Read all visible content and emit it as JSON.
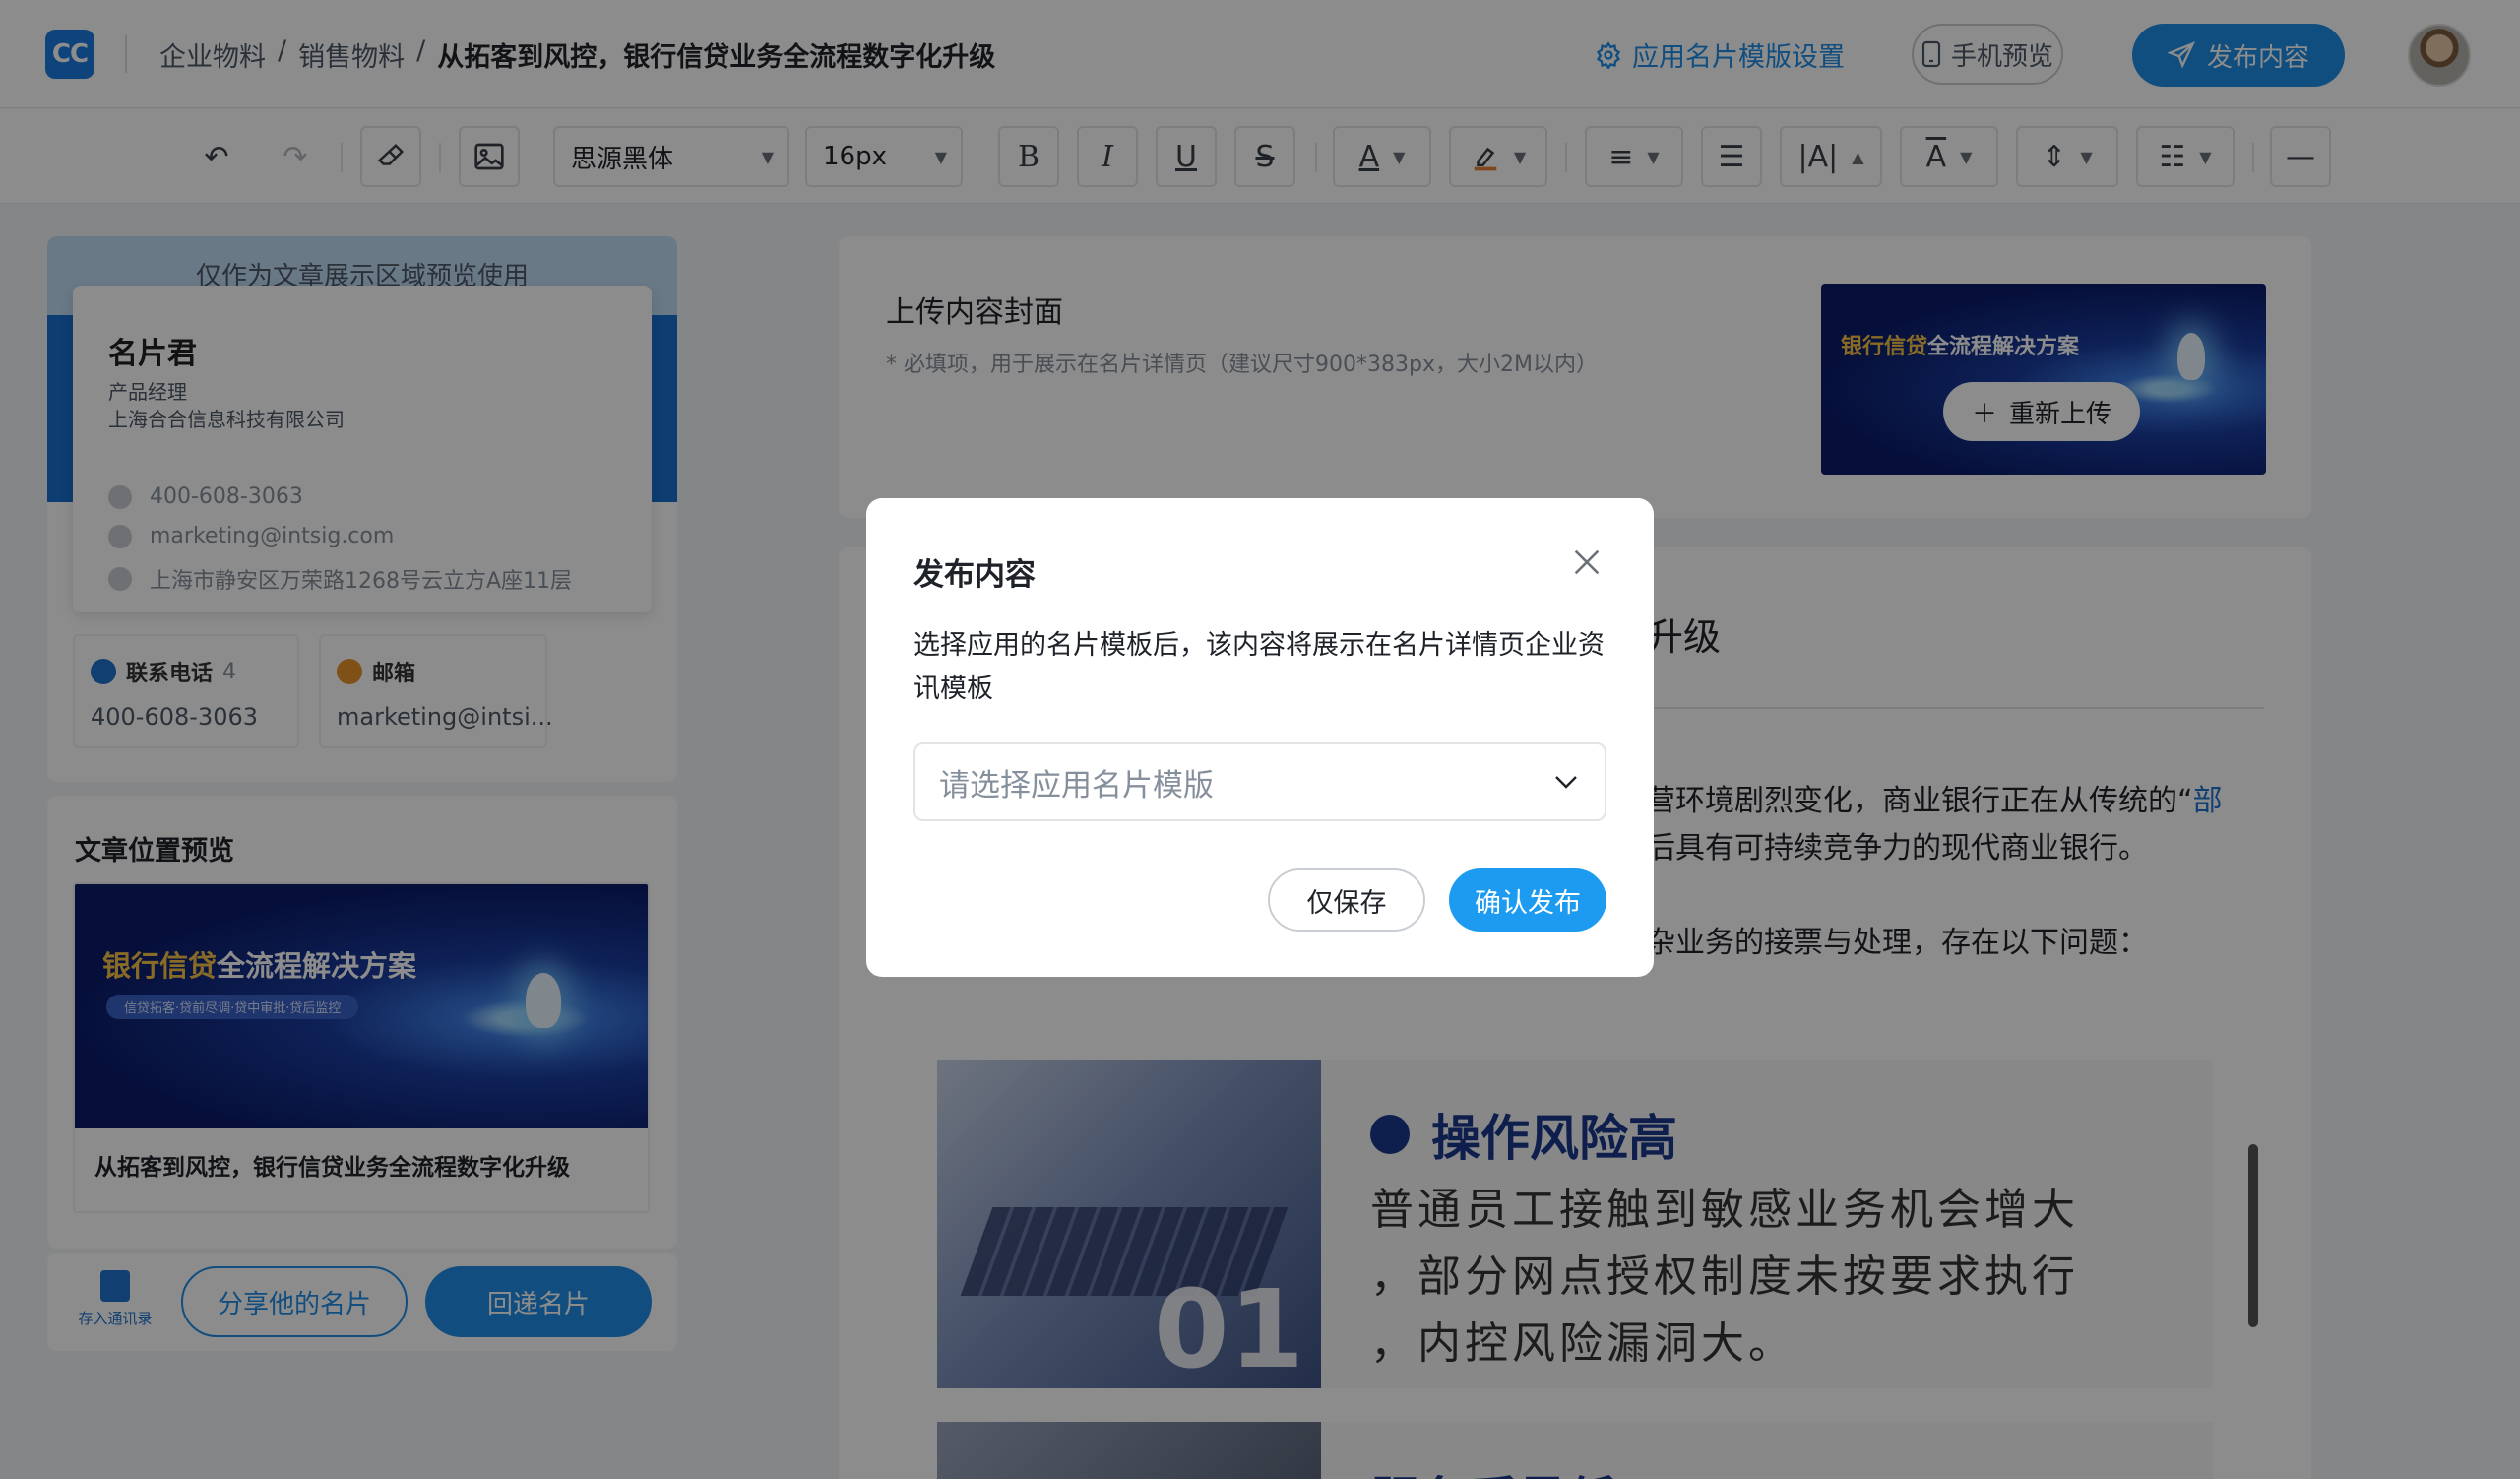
{
  "header": {
    "logo_text": "CC",
    "breadcrumb": [
      "企业物料",
      "销售物料",
      "从拓客到风控，银行信贷业务全流程数字化升级"
    ],
    "breadcrumb_sep": "/",
    "template_settings_label": "应用名片模版设置",
    "mobile_preview_label": "手机预览",
    "publish_label": "发布内容"
  },
  "toolbar": {
    "font_family": "思源黑体",
    "font_size": "16px"
  },
  "card_preview": {
    "note": "仅作为文章展示区域预览使用",
    "name": "名片君",
    "title": "产品经理",
    "company": "上海合合信息科技有限公司",
    "phone": "400-608-3063",
    "email": "marketing@intsig.com",
    "address": "上海市静安区万荣路1268号云立方A座11层",
    "phone_tile_label": "联系电话",
    "phone_tile_count": "4",
    "phone_tile_value": "400-608-3063",
    "email_tile_label": "邮箱",
    "email_tile_value": "marketing@intsi..."
  },
  "article_preview": {
    "heading": "文章位置预览",
    "banner_title_gold": "银行信贷",
    "banner_title_white": "全流程解决方案",
    "banner_subtitle": "信贷拓客·贷前尽调·贷中审批·贷后监控",
    "article_title": "从拓客到风控，银行信贷业务全流程数字化升级"
  },
  "bottom_bar": {
    "save_contacts_label": "存入通讯录",
    "share_label": "分享他的名片",
    "return_card_label": "回递名片"
  },
  "cover": {
    "heading": "上传内容封面",
    "note": "* 必填项，用于展示在名片详情页（建议尺寸900*383px，大小2M以内）",
    "reupload_label": "重新上传"
  },
  "content": {
    "heading_visible": "升级",
    "para1_line1_black": "营环境剧烈变化，商业银行正在从传统的“",
    "para1_line1_blue": "部",
    "para1_line2": "后具有可持续竞争力的现代商业银行。",
    "para2": "杂业务的接票与处理，存在以下问题：",
    "risk1_heading": "操作风险高",
    "risk1_num": "01",
    "risk1_lines": [
      "普通员工接触到敏感业务机会增大",
      "，部分网点授权制度未按要求执行",
      "，内控风险漏洞大。"
    ],
    "risk2_heading": "服务质量低"
  },
  "modal": {
    "title": "发布内容",
    "description": "选择应用的名片模板后，该内容将展示在名片详情页企业资讯模板",
    "select_placeholder": "请选择应用名片模版",
    "save_only_label": "仅保存",
    "confirm_label": "确认发布"
  }
}
